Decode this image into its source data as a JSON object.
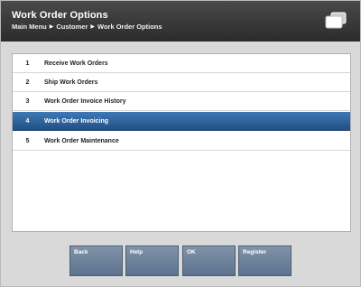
{
  "header": {
    "title": "Work Order Options",
    "breadcrumb": [
      "Main Menu",
      "Customer",
      "Work Order Options"
    ]
  },
  "menu": {
    "selected_index": 3,
    "items": [
      {
        "number": "1",
        "label": "Receive Work Orders"
      },
      {
        "number": "2",
        "label": "Ship Work Orders"
      },
      {
        "number": "3",
        "label": "Work Order Invoice History"
      },
      {
        "number": "4",
        "label": "Work Order Invoicing"
      },
      {
        "number": "5",
        "label": "Work Order Maintenance"
      }
    ]
  },
  "buttons": {
    "back": "Back",
    "help": "Help",
    "ok": "OK",
    "register": "Register"
  },
  "colors": {
    "header_bg": "#333333",
    "selection": "#2f64a0",
    "button": "#6c8099"
  }
}
